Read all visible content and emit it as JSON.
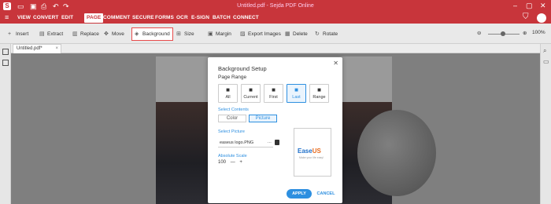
{
  "window": {
    "title": "Untitled.pdf - Sejda PDF Online",
    "app_icon": "S"
  },
  "menu": {
    "items": [
      "VIEW",
      "CONVERT",
      "EDIT",
      "PAGE",
      "COMMENT",
      "SECURE",
      "FORMS",
      "OCR",
      "E-SIGN",
      "BATCH",
      "CONNECT"
    ],
    "active": "PAGE"
  },
  "toolbar": {
    "insert": "Insert",
    "extract": "Extract",
    "replace": "Replace",
    "move": "Move",
    "background": "Background",
    "size": "Size",
    "margin": "Margin",
    "export_images": "Export Images",
    "delete": "Delete",
    "rotate": "Rotate",
    "zoom": "100%"
  },
  "tab": {
    "name": "Untitled.pdf*"
  },
  "dialog": {
    "title": "Background Setup",
    "page_range_label": "Page Range",
    "ranges": [
      "All",
      "Current",
      "First",
      "Last",
      "Range"
    ],
    "selected_range": "Last",
    "select_contents_label": "Select Contents",
    "content_options": [
      "Color",
      "Picture"
    ],
    "selected_content": "Picture",
    "select_picture_label": "Select Picture",
    "picture_file": "easeus logo.PNG",
    "absolute_scale_label": "Absolute Scale",
    "scale_value": "100",
    "preview_logo_main": "Ease",
    "preview_logo_accent": "US",
    "preview_tagline": "Make your life easy!",
    "apply_label": "APPLY",
    "cancel_label": "CANCEL"
  },
  "colors": {
    "brand": "#c8353b",
    "accent": "#2d8fe0"
  }
}
